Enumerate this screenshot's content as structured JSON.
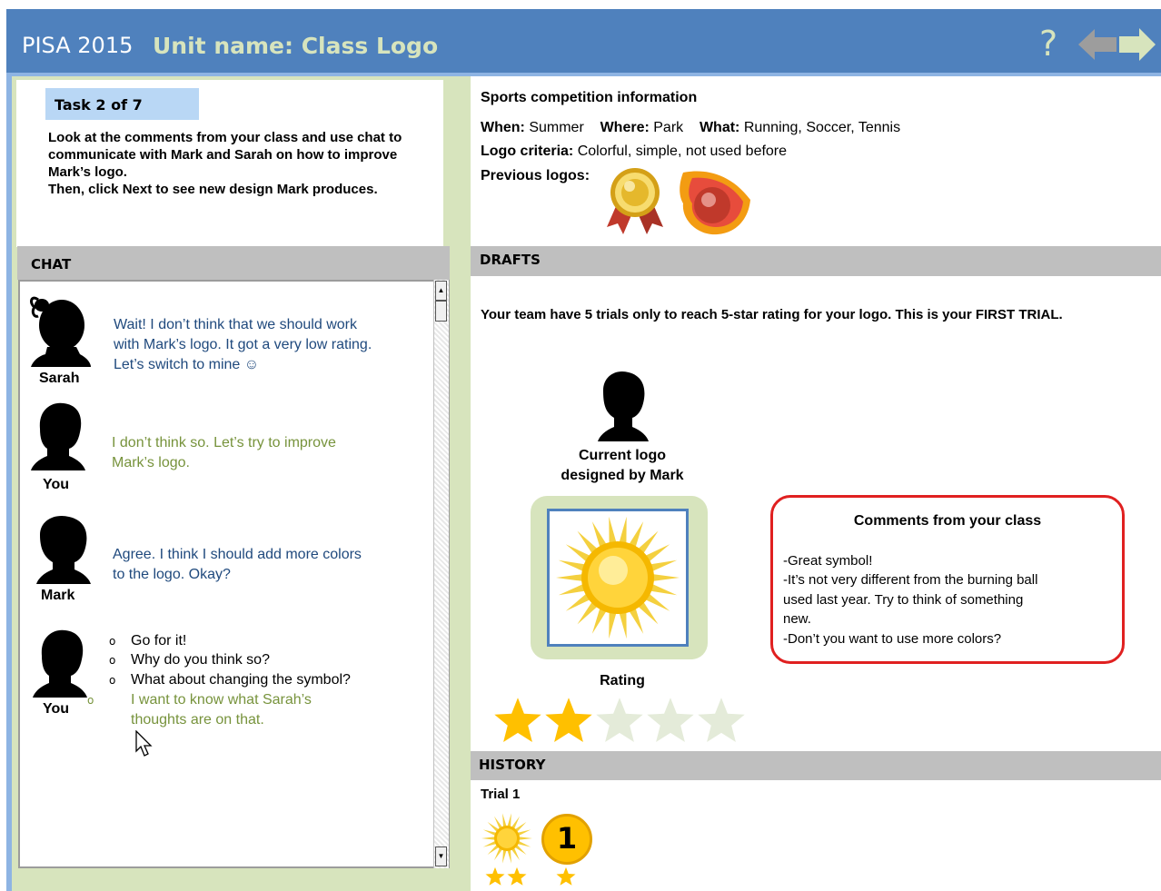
{
  "header": {
    "app_title": "PISA 2015",
    "unit_title": "Unit name: Class Logo",
    "help_label": "?",
    "back_icon": "arrow-left-icon",
    "next_icon": "arrow-right-icon"
  },
  "task": {
    "label": "Task  2 of 7",
    "instructions": "Look at the comments from your class and use chat to communicate with Mark and Sarah on how to improve Mark’s logo.\nThen, click Next to see new design Mark produces."
  },
  "chat": {
    "title": "CHAT",
    "messages": [
      {
        "speaker": "Sarah",
        "text": "Wait! I don’t think that we should work with Mark’s logo. It got a very low rating. Let’s switch to mine ☺"
      },
      {
        "speaker": "You",
        "text": "I don’t think so. Let’s try to improve Mark’s logo."
      },
      {
        "speaker": "Mark",
        "text": "Agree. I think I should add more colors to the logo. Okay?"
      },
      {
        "speaker": "You",
        "options": [
          "Go for it!",
          "Why do you think so?",
          "What about changing the symbol?",
          "I want to know what Sarah’s thoughts are on that."
        ],
        "selected_option": 3
      }
    ],
    "bullet": "o"
  },
  "info": {
    "title": "Sports competition information",
    "when_label": "When:",
    "when_value": "Summer",
    "where_label": "Where:",
    "where_value": "Park",
    "what_label": "What:",
    "what_value": "Running, Soccer, Tennis",
    "criteria_label": "Logo criteria:",
    "criteria_value": "Colorful, simple, not used before",
    "previous_label": "Previous logos:",
    "previous_logos": [
      "medal-icon",
      "fireball-icon"
    ]
  },
  "drafts": {
    "title": "DRAFTS",
    "trial_text": "Your team have 5 trials only to reach 5-star rating for your logo. This is your FIRST TRIAL.",
    "current_logo_label": "Current logo designed by Mark",
    "logo_icon": "sun-icon",
    "rating_label": "Rating",
    "rating": 2,
    "rating_max": 5,
    "comments_title": "Comments from your class",
    "comments": [
      "-Great symbol!",
      "-It’s not very different from the burning ball",
      "used last year. Try to think of something",
      "new.",
      "-Don’t you want to use more colors?"
    ]
  },
  "history": {
    "title": "HISTORY",
    "trial_label": "Trial 1",
    "badge_number": "1",
    "logo_rating": 2,
    "badge_rating": 1
  },
  "colors": {
    "header_blue": "#4f81bd",
    "panel_green": "#d7e4bd",
    "you_text": "#77933c",
    "other_text": "#1f497d",
    "star_filled": "#ffc000",
    "star_empty": "#e4ebd9",
    "comment_border": "#e02020"
  }
}
